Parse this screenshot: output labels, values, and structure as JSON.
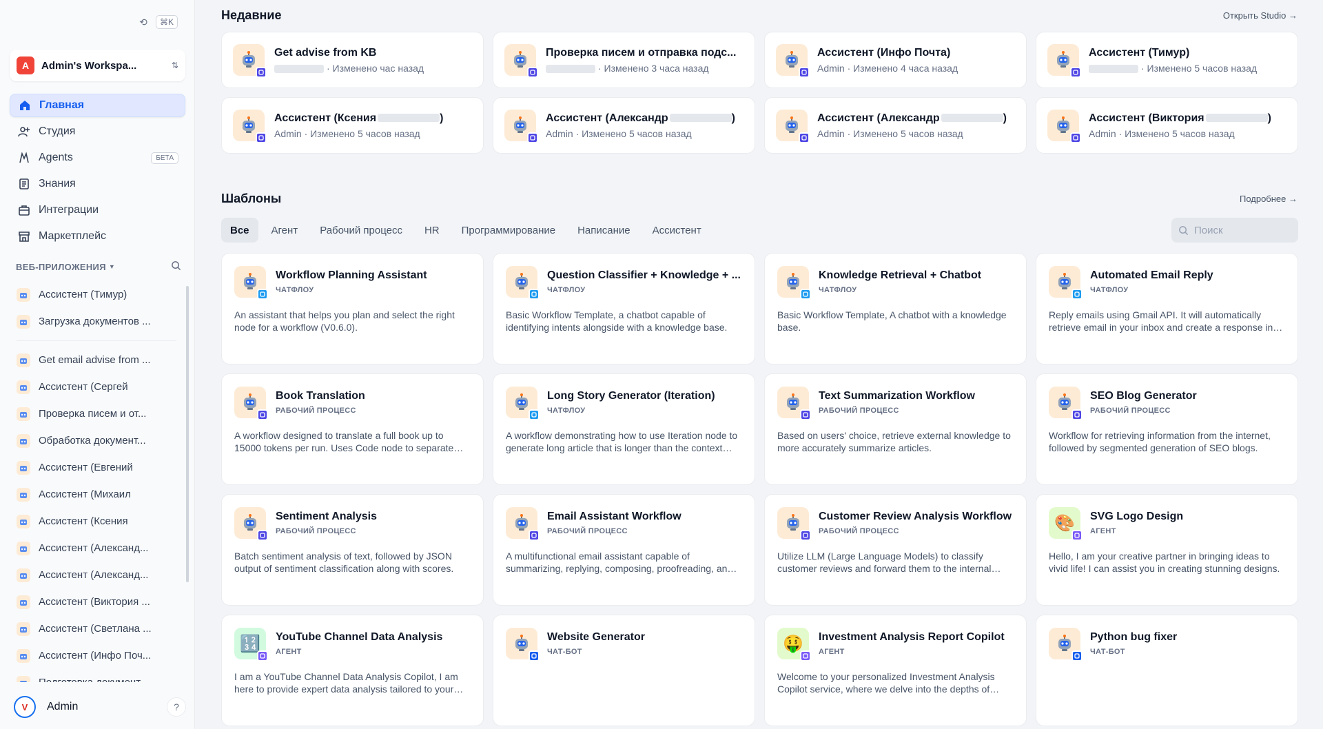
{
  "sidebar": {
    "shortcut": "⌘K",
    "workspace": {
      "initial": "A",
      "name": "Admin's Workspa..."
    },
    "nav": [
      {
        "label": "Главная",
        "icon": "home-icon",
        "active": true
      },
      {
        "label": "Студия",
        "icon": "users-plus-icon"
      },
      {
        "label": "Agents",
        "icon": "agents-icon",
        "badge": "БЕТА"
      },
      {
        "label": "Знания",
        "icon": "book-icon"
      },
      {
        "label": "Интеграции",
        "icon": "briefcase-icon"
      },
      {
        "label": "Маркетплейс",
        "icon": "store-icon"
      }
    ],
    "apps_header": "ВЕБ-ПРИЛОЖЕНИЯ",
    "pinned_apps": [
      "Ассистент (Тимур)",
      "Загрузка документов ..."
    ],
    "apps": [
      "Get email advise from ...",
      "Ассистент (Сергей",
      "Проверка писем и от...",
      "Обработка документ...",
      "Ассистент (Евгений",
      "Ассистент (Михаил",
      "Ассистент (Ксения",
      "Ассистент (Александ...",
      "Ассистент (Александ...",
      "Ассистент (Виктория ...",
      "Ассистент (Светлана ...",
      "Ассистент (Инфо Поч...",
      "Подготовка документ..."
    ],
    "user": {
      "name": "Admin",
      "help": "?"
    }
  },
  "recent": {
    "title": "Недавние",
    "link": "Открыть Studio →",
    "items": [
      {
        "name": "Get advise from KB",
        "meta": "· Изменено час назад",
        "blur_author": true
      },
      {
        "name": "Проверка писем и отправка подс...",
        "meta": "· Изменено 3 часа назад",
        "blur_author": true
      },
      {
        "name": "Ассистент (Инфо Почта)",
        "meta": "Admin · Изменено 4 часа назад"
      },
      {
        "name": "Ассистент (Тимур)",
        "meta": "· Изменено 5 часов назад",
        "blur_author": true
      },
      {
        "name": "Ассистент (Ксения",
        "suffix": ")",
        "meta": "Admin · Изменено 5 часов назад",
        "blur_name": true
      },
      {
        "name": "Ассистент (Александр",
        "suffix": ")",
        "meta": "Admin · Изменено 5 часов назад",
        "blur_name": true
      },
      {
        "name": "Ассистент (Александр",
        "suffix": ")",
        "meta": "Admin · Изменено 5 часов назад",
        "blur_name": true
      },
      {
        "name": "Ассистент (Виктория",
        "suffix": ")",
        "meta": "Admin · Изменено 5 часов назад",
        "blur_name": true
      }
    ]
  },
  "templates": {
    "title": "Шаблоны",
    "link": "Подробнее →",
    "tabs": [
      "Все",
      "Агент",
      "Рабочий процесс",
      "HR",
      "Программирование",
      "Написание",
      "Ассистент"
    ],
    "search_placeholder": "Поиск",
    "items": [
      {
        "title": "Workflow Planning Assistant",
        "type": "ЧАТФЛОУ",
        "kind": "chat",
        "desc": "An assistant that helps you plan and select the right node for a workflow (V0.6.0)."
      },
      {
        "title": "Question Classifier + Knowledge + ...",
        "type": "ЧАТФЛОУ",
        "kind": "chat",
        "desc": "Basic Workflow Template, a chatbot capable of identifying intents alongside with a knowledge base."
      },
      {
        "title": "Knowledge Retrieval + Chatbot",
        "type": "ЧАТФЛОУ",
        "kind": "chat",
        "desc": "Basic Workflow Template, A chatbot with a knowledge base."
      },
      {
        "title": "Automated Email Reply",
        "type": "ЧАТФЛОУ",
        "kind": "chat",
        "desc": "Reply emails using Gmail API. It will automatically retrieve email in your inbox and create a response in Gmail."
      },
      {
        "title": "Book Translation",
        "type": "РАБОЧИЙ ПРОЦЕСС",
        "kind": "wf",
        "desc": "A workflow designed to translate a full book up to 15000 tokens per run. Uses Code node to separate text into chunks."
      },
      {
        "title": "Long Story Generator (Iteration)",
        "type": "ЧАТФЛОУ",
        "kind": "chat",
        "desc": "A workflow demonstrating how to use Iteration node to generate long article that is longer than the context length."
      },
      {
        "title": "Text Summarization Workflow",
        "type": "РАБОЧИЙ ПРОЦЕСС",
        "kind": "wf",
        "desc": "Based on users' choice, retrieve external knowledge to more accurately summarize articles."
      },
      {
        "title": "SEO Blog Generator",
        "type": "РАБОЧИЙ ПРОЦЕСС",
        "kind": "wf",
        "desc": "Workflow for retrieving information from the internet, followed by segmented generation of SEO blogs."
      },
      {
        "title": "Sentiment Analysis",
        "type": "РАБОЧИЙ ПРОЦЕСС",
        "kind": "wf",
        "desc": "Batch sentiment analysis of text, followed by JSON output of sentiment classification along with scores."
      },
      {
        "title": "Email Assistant Workflow",
        "type": "РАБОЧИЙ ПРОЦЕСС",
        "kind": "wf",
        "desc": "A multifunctional email assistant capable of summarizing, replying, composing, proofreading, and checking grammar."
      },
      {
        "title": "Customer Review Analysis Workflow",
        "type": "РАБОЧИЙ ПРОЦЕСС",
        "kind": "wf",
        "desc": "Utilize LLM (Large Language Models) to classify customer reviews and forward them to the internal departments."
      },
      {
        "title": "SVG Logo Design",
        "type": "АГЕНТ",
        "kind": "agent",
        "icon": "🎨",
        "bg": "green",
        "desc": "Hello, I am your creative partner in bringing ideas to vivid life! I can assist you in creating stunning designs."
      },
      {
        "title": "YouTube Channel Data Analysis",
        "type": "АГЕНТ",
        "kind": "agent",
        "icon": "🔢",
        "bg": "mint",
        "desc": "I am a YouTube Channel Data Analysis Copilot, I am here to provide expert data analysis tailored to your needs."
      },
      {
        "title": "Website Generator",
        "type": "ЧАТ-БОТ",
        "kind": "bot",
        "desc": ""
      },
      {
        "title": "Investment Analysis Report Copilot",
        "type": "АГЕНТ",
        "kind": "agent",
        "icon": "🤑",
        "bg": "green",
        "desc": "Welcome to your personalized Investment Analysis Copilot service, where we delve into the depths of stock analysis."
      },
      {
        "title": "Python bug fixer",
        "type": "ЧАТ-БОТ",
        "kind": "bot",
        "desc": ""
      }
    ]
  }
}
